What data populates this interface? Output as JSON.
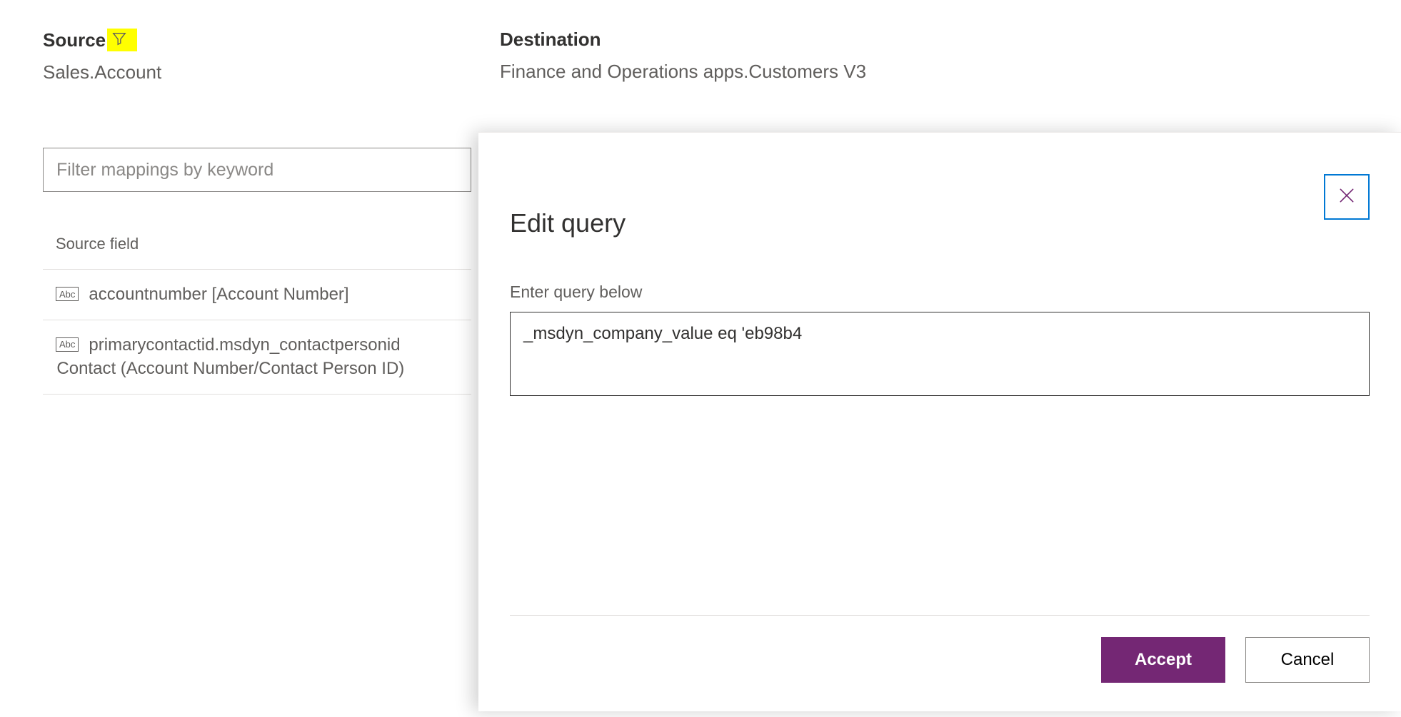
{
  "header": {
    "source_label": "Source",
    "source_value": "Sales.Account",
    "destination_label": "Destination",
    "destination_value": "Finance and Operations apps.Customers V3"
  },
  "filter": {
    "placeholder": "Filter mappings by keyword"
  },
  "grid": {
    "col_header": "Source field",
    "abc_badge": "Abc",
    "rows": [
      {
        "text": "accountnumber [Account Number]"
      },
      {
        "line1": "primarycontactid.msdyn_contactpersonid",
        "line2": "Contact (Account Number/Contact Person ID)"
      }
    ]
  },
  "dialog": {
    "title": "Edit query",
    "label": "Enter query below",
    "query_value": "_msdyn_company_value eq 'eb98b4",
    "accept": "Accept",
    "cancel": "Cancel"
  }
}
